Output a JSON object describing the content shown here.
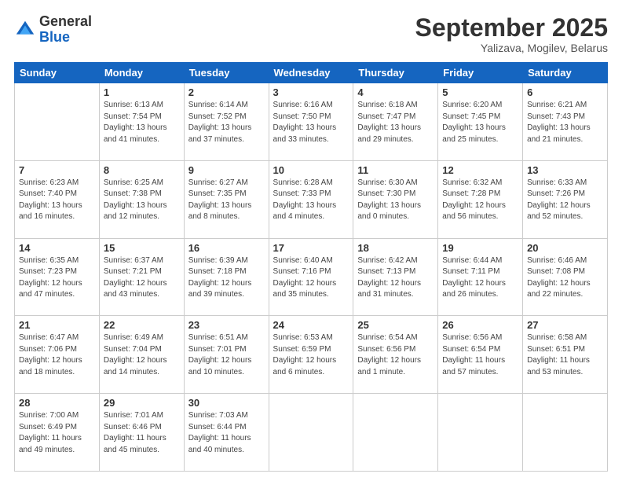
{
  "logo": {
    "general": "General",
    "blue": "Blue"
  },
  "title": "September 2025",
  "location": "Yalizava, Mogilev, Belarus",
  "weekdays": [
    "Sunday",
    "Monday",
    "Tuesday",
    "Wednesday",
    "Thursday",
    "Friday",
    "Saturday"
  ],
  "weeks": [
    [
      {
        "day": "",
        "sunrise": "",
        "sunset": "",
        "daylight": ""
      },
      {
        "day": "1",
        "sunrise": "Sunrise: 6:13 AM",
        "sunset": "Sunset: 7:54 PM",
        "daylight": "Daylight: 13 hours and 41 minutes."
      },
      {
        "day": "2",
        "sunrise": "Sunrise: 6:14 AM",
        "sunset": "Sunset: 7:52 PM",
        "daylight": "Daylight: 13 hours and 37 minutes."
      },
      {
        "day": "3",
        "sunrise": "Sunrise: 6:16 AM",
        "sunset": "Sunset: 7:50 PM",
        "daylight": "Daylight: 13 hours and 33 minutes."
      },
      {
        "day": "4",
        "sunrise": "Sunrise: 6:18 AM",
        "sunset": "Sunset: 7:47 PM",
        "daylight": "Daylight: 13 hours and 29 minutes."
      },
      {
        "day": "5",
        "sunrise": "Sunrise: 6:20 AM",
        "sunset": "Sunset: 7:45 PM",
        "daylight": "Daylight: 13 hours and 25 minutes."
      },
      {
        "day": "6",
        "sunrise": "Sunrise: 6:21 AM",
        "sunset": "Sunset: 7:43 PM",
        "daylight": "Daylight: 13 hours and 21 minutes."
      }
    ],
    [
      {
        "day": "7",
        "sunrise": "Sunrise: 6:23 AM",
        "sunset": "Sunset: 7:40 PM",
        "daylight": "Daylight: 13 hours and 16 minutes."
      },
      {
        "day": "8",
        "sunrise": "Sunrise: 6:25 AM",
        "sunset": "Sunset: 7:38 PM",
        "daylight": "Daylight: 13 hours and 12 minutes."
      },
      {
        "day": "9",
        "sunrise": "Sunrise: 6:27 AM",
        "sunset": "Sunset: 7:35 PM",
        "daylight": "Daylight: 13 hours and 8 minutes."
      },
      {
        "day": "10",
        "sunrise": "Sunrise: 6:28 AM",
        "sunset": "Sunset: 7:33 PM",
        "daylight": "Daylight: 13 hours and 4 minutes."
      },
      {
        "day": "11",
        "sunrise": "Sunrise: 6:30 AM",
        "sunset": "Sunset: 7:30 PM",
        "daylight": "Daylight: 13 hours and 0 minutes."
      },
      {
        "day": "12",
        "sunrise": "Sunrise: 6:32 AM",
        "sunset": "Sunset: 7:28 PM",
        "daylight": "Daylight: 12 hours and 56 minutes."
      },
      {
        "day": "13",
        "sunrise": "Sunrise: 6:33 AM",
        "sunset": "Sunset: 7:26 PM",
        "daylight": "Daylight: 12 hours and 52 minutes."
      }
    ],
    [
      {
        "day": "14",
        "sunrise": "Sunrise: 6:35 AM",
        "sunset": "Sunset: 7:23 PM",
        "daylight": "Daylight: 12 hours and 47 minutes."
      },
      {
        "day": "15",
        "sunrise": "Sunrise: 6:37 AM",
        "sunset": "Sunset: 7:21 PM",
        "daylight": "Daylight: 12 hours and 43 minutes."
      },
      {
        "day": "16",
        "sunrise": "Sunrise: 6:39 AM",
        "sunset": "Sunset: 7:18 PM",
        "daylight": "Daylight: 12 hours and 39 minutes."
      },
      {
        "day": "17",
        "sunrise": "Sunrise: 6:40 AM",
        "sunset": "Sunset: 7:16 PM",
        "daylight": "Daylight: 12 hours and 35 minutes."
      },
      {
        "day": "18",
        "sunrise": "Sunrise: 6:42 AM",
        "sunset": "Sunset: 7:13 PM",
        "daylight": "Daylight: 12 hours and 31 minutes."
      },
      {
        "day": "19",
        "sunrise": "Sunrise: 6:44 AM",
        "sunset": "Sunset: 7:11 PM",
        "daylight": "Daylight: 12 hours and 26 minutes."
      },
      {
        "day": "20",
        "sunrise": "Sunrise: 6:46 AM",
        "sunset": "Sunset: 7:08 PM",
        "daylight": "Daylight: 12 hours and 22 minutes."
      }
    ],
    [
      {
        "day": "21",
        "sunrise": "Sunrise: 6:47 AM",
        "sunset": "Sunset: 7:06 PM",
        "daylight": "Daylight: 12 hours and 18 minutes."
      },
      {
        "day": "22",
        "sunrise": "Sunrise: 6:49 AM",
        "sunset": "Sunset: 7:04 PM",
        "daylight": "Daylight: 12 hours and 14 minutes."
      },
      {
        "day": "23",
        "sunrise": "Sunrise: 6:51 AM",
        "sunset": "Sunset: 7:01 PM",
        "daylight": "Daylight: 12 hours and 10 minutes."
      },
      {
        "day": "24",
        "sunrise": "Sunrise: 6:53 AM",
        "sunset": "Sunset: 6:59 PM",
        "daylight": "Daylight: 12 hours and 6 minutes."
      },
      {
        "day": "25",
        "sunrise": "Sunrise: 6:54 AM",
        "sunset": "Sunset: 6:56 PM",
        "daylight": "Daylight: 12 hours and 1 minute."
      },
      {
        "day": "26",
        "sunrise": "Sunrise: 6:56 AM",
        "sunset": "Sunset: 6:54 PM",
        "daylight": "Daylight: 11 hours and 57 minutes."
      },
      {
        "day": "27",
        "sunrise": "Sunrise: 6:58 AM",
        "sunset": "Sunset: 6:51 PM",
        "daylight": "Daylight: 11 hours and 53 minutes."
      }
    ],
    [
      {
        "day": "28",
        "sunrise": "Sunrise: 7:00 AM",
        "sunset": "Sunset: 6:49 PM",
        "daylight": "Daylight: 11 hours and 49 minutes."
      },
      {
        "day": "29",
        "sunrise": "Sunrise: 7:01 AM",
        "sunset": "Sunset: 6:46 PM",
        "daylight": "Daylight: 11 hours and 45 minutes."
      },
      {
        "day": "30",
        "sunrise": "Sunrise: 7:03 AM",
        "sunset": "Sunset: 6:44 PM",
        "daylight": "Daylight: 11 hours and 40 minutes."
      },
      {
        "day": "",
        "sunrise": "",
        "sunset": "",
        "daylight": ""
      },
      {
        "day": "",
        "sunrise": "",
        "sunset": "",
        "daylight": ""
      },
      {
        "day": "",
        "sunrise": "",
        "sunset": "",
        "daylight": ""
      },
      {
        "day": "",
        "sunrise": "",
        "sunset": "",
        "daylight": ""
      }
    ]
  ]
}
